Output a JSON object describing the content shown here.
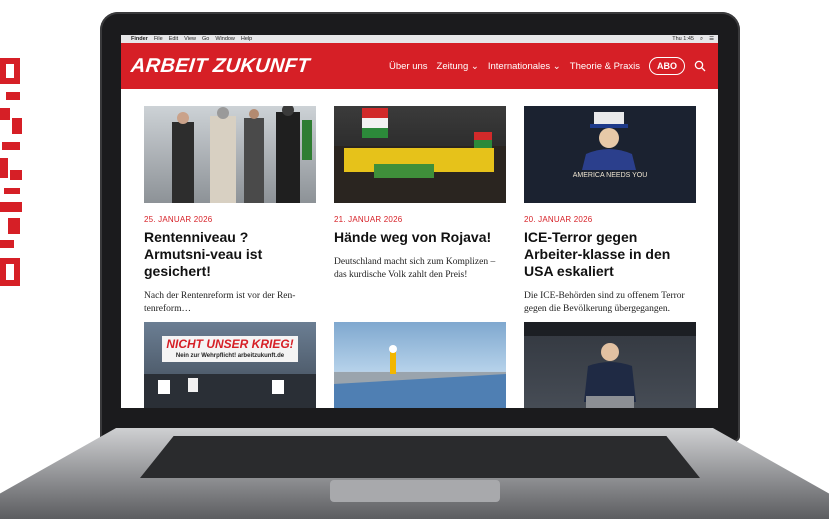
{
  "menubar": {
    "items": [
      "Finder",
      "File",
      "Edit",
      "View",
      "Go",
      "Window",
      "Help"
    ],
    "clock": "Thu 1:45"
  },
  "site": {
    "logo": "ARBEIT ZUKUNFT",
    "nav": {
      "items": [
        "Über uns",
        "Zeitung ⌄",
        "Internationales ⌄",
        "Theorie & Praxis"
      ],
      "abo": "ABO"
    },
    "brand_color": "#d61f26"
  },
  "articles": [
    {
      "date": "25. JANUAR 2026",
      "title": "Rentenniveau ? Armutsni-veau ist gesichert!",
      "excerpt": "Nach der Rentenreform ist vor der Ren-tenreform…"
    },
    {
      "date": "21. JANUAR 2026",
      "title": "Hände weg von Rojava!",
      "excerpt": "Deutschland macht sich zum Komplizen – das kurdische Volk zahlt den Preis!"
    },
    {
      "date": "20. JANUAR 2026",
      "title": "ICE-Terror gegen Arbeiter-klasse in den USA eskaliert",
      "excerpt": "Die ICE-Behörden sind zu offenem Terror gegen die Bevölkerung übergegangen.",
      "image_text": "AMERICA NEEDS YOU"
    }
  ],
  "row2": {
    "banner_text": "NICHT UNSER KRIEG!",
    "banner_sub": "Nein zur Wehrpflicht! arbeitzukunft.de"
  }
}
